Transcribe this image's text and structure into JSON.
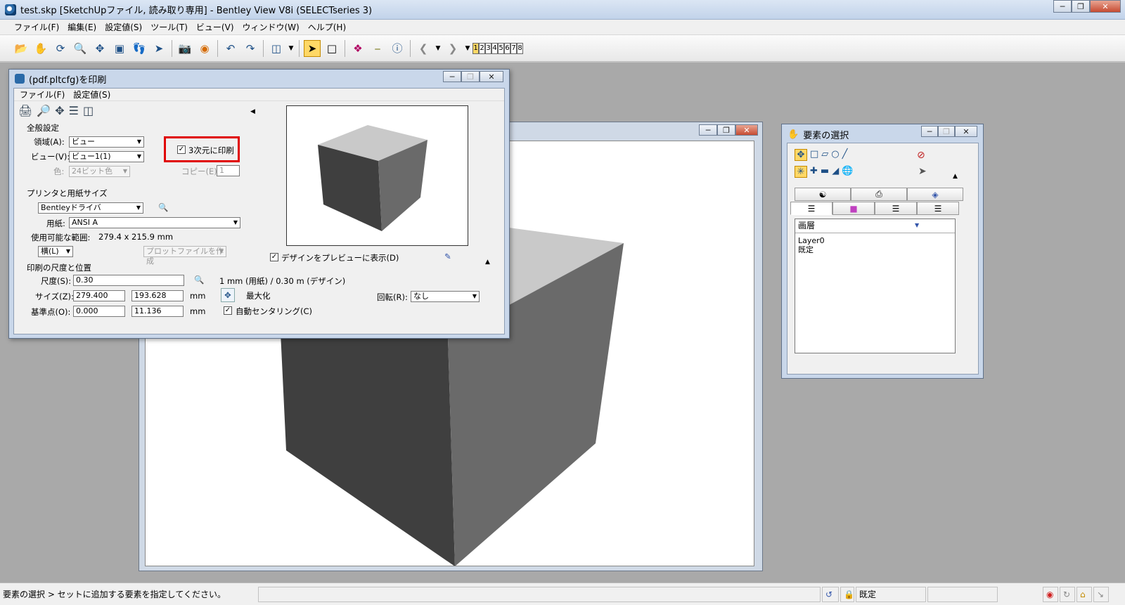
{
  "app": {
    "title": "test.skp [SketchUpファイル, 読み取り専用] - Bentley View V8i (SELECTseries 3)"
  },
  "menu": [
    "ファイル(F)",
    "編集(E)",
    "設定値(S)",
    "ツール(T)",
    "ビュー(V)",
    "ウィンドウ(W)",
    "ヘルプ(H)"
  ],
  "toolbar": {
    "view_numbers": [
      "1",
      "2",
      "3",
      "4",
      "5",
      "6",
      "7",
      "8"
    ]
  },
  "print_dialog": {
    "title": "(pdf.pltcfg)を印刷",
    "menu": [
      "ファイル(F)",
      "設定値(S)"
    ],
    "general": {
      "heading": "全般設定",
      "area_label": "領域(A):",
      "area_value": "ビュー",
      "view_label": "ビュー(V):",
      "view_value": "ビュー1(1)",
      "color_label": "色:",
      "color_value": "24ビット色",
      "print3d_label": "3次元に印刷",
      "print3d_checked": true,
      "copies_label": "コピー(E):",
      "copies_value": "1"
    },
    "printer": {
      "heading": "プリンタと用紙サイズ",
      "driver": "Bentleyドライバ",
      "paper_label": "用紙:",
      "paper_value": "ANSI A",
      "usable_label": "使用可能な範囲:",
      "usable_value": "279.4 x 215.9 mm",
      "orientation": "横(L)",
      "plotfile_button": "プロットファイルを作成"
    },
    "preview_checkbox": "デザインをプレビューに表示(D)",
    "scale": {
      "heading": "印刷の尺度と位置",
      "scale_label": "尺度(S):",
      "scale_value": "0.30",
      "ratio_text": "1 mm (用紙) / 0.30 m (デザイン)",
      "size_label": "サイズ(Z):",
      "size_w": "279.400",
      "size_h": "193.628",
      "size_unit": "mm",
      "origin_label": "基準点(O):",
      "origin_x": "0.000",
      "origin_y": "11.136",
      "origin_unit": "mm",
      "maximize": "最大化",
      "autocenter": "自動センタリング(C)",
      "rotation_label": "回転(R):",
      "rotation_value": "なし"
    }
  },
  "selection_panel": {
    "title": "要素の選択",
    "list_header": "画層",
    "list_items": [
      "Layer0",
      "既定"
    ]
  },
  "status": {
    "message": "要素の選択 > セットに追加する要素を指定してください。",
    "level": "既定"
  }
}
